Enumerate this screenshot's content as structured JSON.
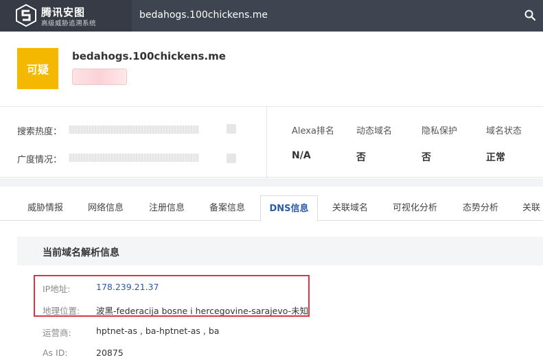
{
  "topbar": {
    "brand_name": "腾讯安图",
    "brand_subtitle": "高级威胁追溯系统",
    "search_value": "bedahogs.100chickens.me",
    "search_icon": "search-icon"
  },
  "header": {
    "badge_text": "可疑",
    "badge_color": "#f5b800",
    "domain": "bedahogs.100chickens.me"
  },
  "info": {
    "search_heat_label": "搜索热度：",
    "breadth_label": "广度情况：",
    "stats": [
      {
        "label": "Alexa排名",
        "value": "N/A"
      },
      {
        "label": "动态域名",
        "value": "否"
      },
      {
        "label": "隐私保护",
        "value": "否"
      },
      {
        "label": "域名状态",
        "value": "正常"
      }
    ]
  },
  "tabs": [
    {
      "label": "威胁情报",
      "active": false
    },
    {
      "label": "网络信息",
      "active": false
    },
    {
      "label": "注册信息",
      "active": false
    },
    {
      "label": "备案信息",
      "active": false
    },
    {
      "label": "DNS信息",
      "active": true
    },
    {
      "label": "关联域名",
      "active": false
    },
    {
      "label": "可视化分析",
      "active": false
    },
    {
      "label": "态势分析",
      "active": false
    },
    {
      "label": "关联",
      "active": false
    }
  ],
  "dns": {
    "section_title": "当前域名解析信息",
    "rows": [
      {
        "label": "IP地址:",
        "value": "178.239.21.37"
      },
      {
        "label": "地理位置:",
        "value": "波黑-federacija bosne i hercegovine-sarajevo-未知"
      },
      {
        "label": "运营商:",
        "value": "hptnet-as , ba-hptnet-as , ba"
      },
      {
        "label": "As ID:",
        "value": "20875"
      }
    ],
    "highlight_color": "#d9363e"
  },
  "colors": {
    "topbar": "#3e4450",
    "accent_link": "#2b5aa8"
  }
}
